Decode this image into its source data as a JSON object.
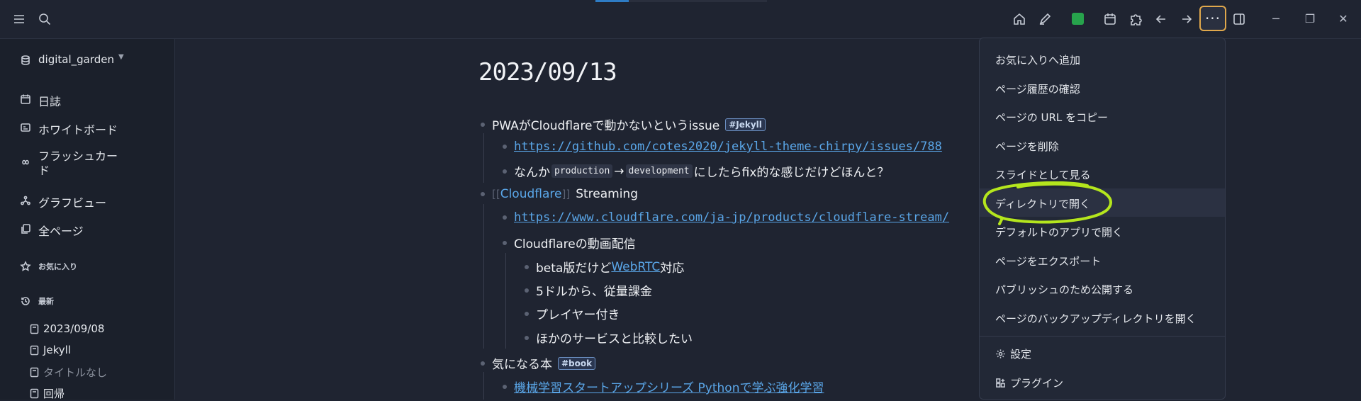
{
  "topbar": {
    "icons": [
      "menu-icon",
      "search-icon",
      "home-icon",
      "edit-icon",
      "calendar-icon",
      "puzzle-icon",
      "arrow-left-icon",
      "arrow-right-icon",
      "more-icon",
      "sidebar-toggle-icon"
    ],
    "more_label": "···",
    "minimize": "─",
    "maximize": "❐",
    "close": "✕",
    "accent_color": "#e0a84c"
  },
  "sidebar": {
    "graph_name": "digital_garden",
    "nav": [
      {
        "label": "日誌",
        "icon": "calendar-icon"
      },
      {
        "label": "ホワイトボード",
        "icon": "whiteboard-icon"
      },
      {
        "label": "フラッシュカー",
        "label2": "ド",
        "icon": "infinity-icon"
      },
      {
        "label": "グラフビュー",
        "icon": "graph-icon"
      },
      {
        "label": "全ページ",
        "icon": "pages-icon"
      }
    ],
    "favorites_label": "お気に入り",
    "recent_label": "最新",
    "recent": [
      "2023/09/08",
      "Jekyll",
      "タイトルなし",
      "回帰"
    ]
  },
  "page": {
    "title": "2023/09/13",
    "blocks": {
      "b1": {
        "text": "PWAがCloudflareで動かないというissue",
        "tag": "#Jekyll"
      },
      "b1_link": "https://github.com/cotes2020/jekyll-theme-chirpy/issues/788",
      "b1_2": {
        "pre": "なんか",
        "code1": "production",
        "arrow": "→",
        "code2": "development",
        "post": "にしたらfix的な感じだけどほんと？"
      },
      "b2": {
        "ref": "Cloudflare",
        "text": "Streaming",
        "open": "[[",
        "close": "]]"
      },
      "b2_link": "https://www.cloudflare.com/ja-jp/products/cloudflare-stream/",
      "b2_2": "Cloudflareの動画配信",
      "b2_2_1": {
        "pre": "beta版だけど",
        "link": "WebRTC",
        "post": "対応"
      },
      "b2_2_2": "5ドルから、従量課金",
      "b2_2_3": "プレイヤー付き",
      "b2_2_4": "ほかのサービスと比較したい",
      "b3": {
        "text": "気になる本",
        "tag": "#book"
      },
      "b3_link": "機械学習スタートアップシリーズ Pythonで学ぶ強化学習"
    }
  },
  "menu": {
    "items": [
      "お気に入りへ追加",
      "ページ履歴の確認",
      "ページの URL をコピー",
      "ページを削除",
      "スライドとして見る",
      "ディレクトリで開く",
      "デフォルトのアプリで開く",
      "ページをエクスポート",
      "パブリッシュのため公開する",
      "ページのバックアップディレクトリを開く"
    ],
    "settings": "設定",
    "plugins": "プラグイン",
    "highlight_color": "#b5e61d"
  }
}
